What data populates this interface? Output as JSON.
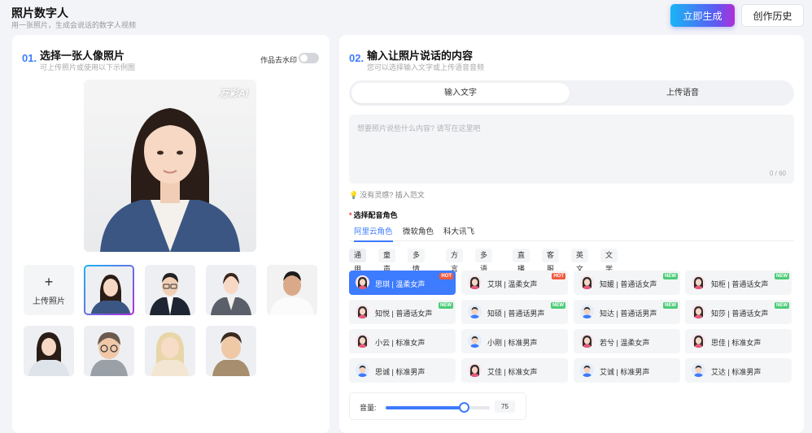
{
  "header": {
    "title": "照片数字人",
    "subtitle": "用一张照片，生成会说话的数字人视频",
    "generate_label": "立即生成",
    "history_label": "创作历史"
  },
  "left": {
    "num": "01.",
    "title": "选择一张人像照片",
    "subtitle": "可上传照片或使用以下示例图",
    "watermark_toggle_label": "作品去水印",
    "watermark_toggle_on": false,
    "preview_watermark": "万彩AI",
    "upload_label": "上传照片",
    "upload_icon": "plus-icon",
    "selected_index": 0,
    "thumbnails": [
      {
        "name": "woman-suit"
      },
      {
        "name": "man-glasses-suit"
      },
      {
        "name": "woman-uniform"
      },
      {
        "name": "man-white-shirt"
      },
      {
        "name": "girl-sweater"
      },
      {
        "name": "cartoon-boy-glasses"
      },
      {
        "name": "cartoon-girl-blonde"
      },
      {
        "name": "cartoon-boy-jacket"
      }
    ]
  },
  "right": {
    "num": "02.",
    "title": "输入让照片说话的内容",
    "subtitle": "您可以选择输入文字或上传语音音频",
    "tabs": [
      {
        "label": "输入文字",
        "active": true
      },
      {
        "label": "上传语音",
        "active": false
      }
    ],
    "text_placeholder": "想要照片说些什么内容? 请写在这里吧",
    "counter": "0 / 60",
    "inspiration": "没有灵感? 插入范文",
    "voice_title": "选择配音角色",
    "voice_tabs": [
      {
        "label": "阿里云角色",
        "active": true
      },
      {
        "label": "微软角色",
        "active": false
      },
      {
        "label": "科大讯飞",
        "active": false
      }
    ],
    "categories": [
      "通用",
      "童声",
      "多情感",
      "方言",
      "多语种",
      "直播",
      "客服",
      "英文",
      "文学"
    ],
    "voices": [
      {
        "name": "思琪 | 温柔女声",
        "badge": "HOT",
        "gender": "female",
        "active": true
      },
      {
        "name": "艾琪 | 温柔女声",
        "badge": "HOT",
        "gender": "female",
        "active": false
      },
      {
        "name": "知媛 | 普通话女声",
        "badge": "NEW",
        "gender": "female",
        "active": false
      },
      {
        "name": "知柜 | 普通话女声",
        "badge": "NEW",
        "gender": "female",
        "active": false
      },
      {
        "name": "知悦 | 普通话女声",
        "badge": "NEW",
        "gender": "female",
        "active": false
      },
      {
        "name": "知硕 | 普通话男声",
        "badge": "NEW",
        "gender": "male",
        "active": false
      },
      {
        "name": "知达 | 普通话男声",
        "badge": "NEW",
        "gender": "male",
        "active": false
      },
      {
        "name": "知莎 | 普通话女声",
        "badge": "NEW",
        "gender": "female",
        "active": false
      },
      {
        "name": "小云 | 标准女声",
        "badge": "",
        "gender": "female",
        "active": false
      },
      {
        "name": "小刚 | 标准男声",
        "badge": "",
        "gender": "male",
        "active": false
      },
      {
        "name": "若兮 | 温柔女声",
        "badge": "",
        "gender": "female",
        "active": false
      },
      {
        "name": "思佳 | 标准女声",
        "badge": "",
        "gender": "female",
        "active": false
      },
      {
        "name": "思诚 | 标准男声",
        "badge": "",
        "gender": "male",
        "active": false
      },
      {
        "name": "艾佳 | 标准女声",
        "badge": "",
        "gender": "female",
        "active": false
      },
      {
        "name": "艾诚 | 标准男声",
        "badge": "",
        "gender": "male",
        "active": false
      },
      {
        "name": "艾达 | 标准男声",
        "badge": "",
        "gender": "male",
        "active": false
      }
    ],
    "volume_label": "音量:",
    "volume_value": "75",
    "volume_percent": 75
  },
  "colors": {
    "accent": "#3d7bff",
    "hot": "#f25a3e",
    "new": "#4ccc77"
  }
}
